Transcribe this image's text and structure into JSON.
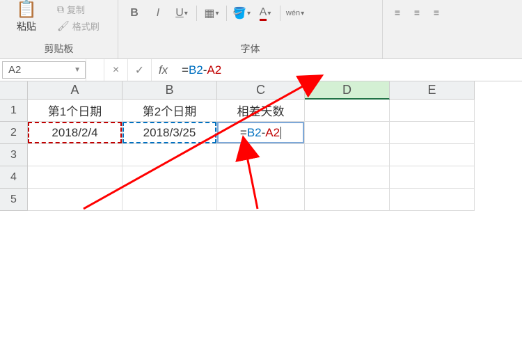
{
  "ribbon": {
    "clipboard": {
      "paste_label": "粘贴",
      "copy_label": "复制",
      "format_painter_label": "格式刷",
      "group_label": "剪贴板"
    },
    "font": {
      "group_label": "字体",
      "bold": "B",
      "italic": "I",
      "underline": "U",
      "wen": "wén"
    }
  },
  "formula_bar": {
    "name_box": "A2",
    "cancel": "×",
    "enter": "✓",
    "fx": "fx",
    "equals": "=",
    "ref_b": "B2",
    "minus": "-",
    "ref_a": "A2"
  },
  "columns": [
    "A",
    "B",
    "C",
    "D",
    "E"
  ],
  "rows": [
    "1",
    "2",
    "3",
    "4",
    "5"
  ],
  "sheet": {
    "headers": {
      "a1": "第1个日期",
      "b1": "第2个日期",
      "c1": "相差天数"
    },
    "data": {
      "a2": "2018/2/4",
      "b2": "2018/3/25"
    },
    "editing": {
      "equals": "=",
      "ref_b": "B2",
      "minus": "-",
      "ref_a": "A2"
    }
  }
}
